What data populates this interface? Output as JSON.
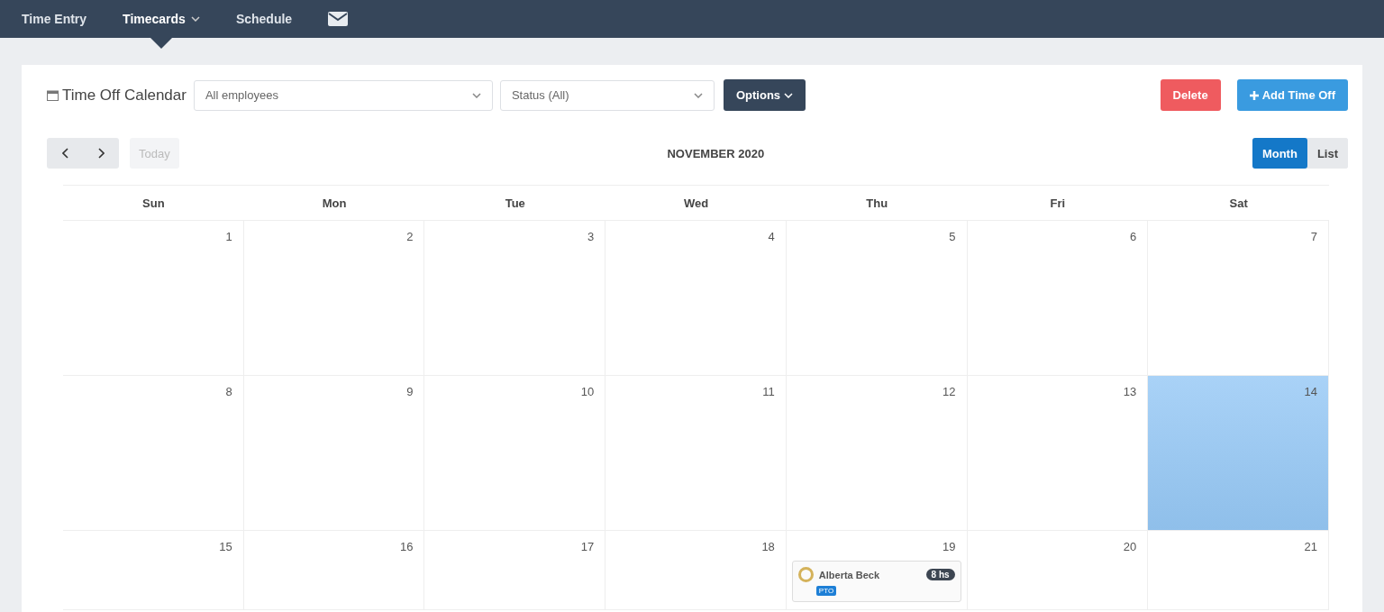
{
  "nav": [
    {
      "label": "Time Entry",
      "selected": false,
      "dropdown": false,
      "kind": "text"
    },
    {
      "label": "Timecards",
      "selected": true,
      "dropdown": true,
      "kind": "text"
    },
    {
      "label": "Schedule",
      "selected": false,
      "dropdown": false,
      "kind": "text"
    },
    {
      "kind": "mail"
    }
  ],
  "toolbar": {
    "title": "Time Off Calendar",
    "employee_filter": "All employees",
    "status_filter": "Status (All)",
    "options": "Options",
    "delete": "Delete",
    "add": "Add Time Off"
  },
  "calendar": {
    "today": "Today",
    "title": "NOVEMBER 2020",
    "views": [
      {
        "label": "Month",
        "selected": true
      },
      {
        "label": "List",
        "selected": false
      }
    ],
    "weekdays": [
      "Sun",
      "Mon",
      "Tue",
      "Wed",
      "Thu",
      "Fri",
      "Sat"
    ],
    "weeks": [
      [
        {
          "day": "1",
          "selected": false
        },
        {
          "day": "2",
          "selected": false
        },
        {
          "day": "3",
          "selected": false
        },
        {
          "day": "4",
          "selected": false
        },
        {
          "day": "5",
          "selected": false
        },
        {
          "day": "6",
          "selected": false
        },
        {
          "day": "7",
          "selected": false
        }
      ],
      [
        {
          "day": "8",
          "selected": false
        },
        {
          "day": "9",
          "selected": false
        },
        {
          "day": "10",
          "selected": false
        },
        {
          "day": "11",
          "selected": false
        },
        {
          "day": "12",
          "selected": false
        },
        {
          "day": "13",
          "selected": false
        },
        {
          "day": "14",
          "selected": true
        }
      ],
      [
        {
          "day": "15",
          "selected": false
        },
        {
          "day": "16",
          "selected": false
        },
        {
          "day": "17",
          "selected": false
        },
        {
          "day": "18",
          "selected": false
        },
        {
          "day": "19",
          "selected": false,
          "events": [
            {
              "name": "Alberta Beck",
              "hours": "8 hs",
              "tag": "PTO",
              "color": "#d4b25a"
            }
          ]
        },
        {
          "day": "20",
          "selected": false
        },
        {
          "day": "21",
          "selected": false
        }
      ]
    ]
  }
}
